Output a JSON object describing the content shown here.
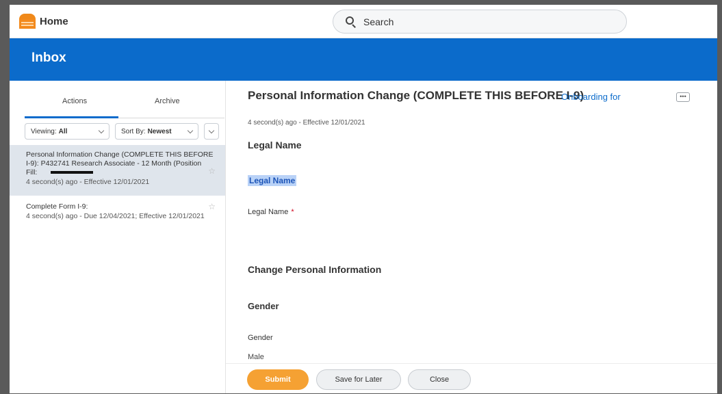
{
  "topbar": {
    "home_label": "Home",
    "search_placeholder": "Search"
  },
  "header": {
    "title": "Inbox"
  },
  "left_panel": {
    "tabs": [
      {
        "label": "Actions",
        "active": true
      },
      {
        "label": "Archive",
        "active": false
      }
    ],
    "viewing": {
      "label": "Viewing:",
      "value": "All"
    },
    "sort": {
      "label": "Sort By:",
      "value": "Newest"
    },
    "items": [
      {
        "title_line1": "Personal Information Change (COMPLETE THIS BEFORE",
        "title_line2": "I-9): P432741 Research Associate - 12 Month (Position",
        "title_line3": "Fill:",
        "subtitle": "4 second(s) ago - Effective 12/01/2021",
        "selected": true
      },
      {
        "title_line1": "Complete Form I-9:",
        "subtitle": "4 second(s) ago - Due 12/04/2021; Effective 12/01/2021",
        "selected": false
      }
    ]
  },
  "detail": {
    "title": "Personal Information Change (COMPLETE THIS BEFORE I-9)",
    "onboarding_link": "Onboarding for",
    "more_label": "•••",
    "meta": "4 second(s) ago - Effective 12/01/2021",
    "section_legal_name": "Legal Name",
    "legal_name_highlight": "Legal Name",
    "legal_name_field_label": "Legal Name",
    "required_marker": "*",
    "section_change": "Change Personal Information",
    "section_gender": "Gender",
    "gender_field_label": "Gender",
    "gender_value": "Male"
  },
  "footer": {
    "submit": "Submit",
    "save_for_later": "Save for Later",
    "close": "Close"
  },
  "colors": {
    "brand_blue": "#0b6bcb",
    "submit_orange": "#f5a133",
    "home_icon_orange": "#f38a1d",
    "required_red": "#d0021b"
  },
  "icons": {
    "home": "home-icon",
    "search": "search-icon",
    "star": "star-icon",
    "more": "more-icon"
  }
}
